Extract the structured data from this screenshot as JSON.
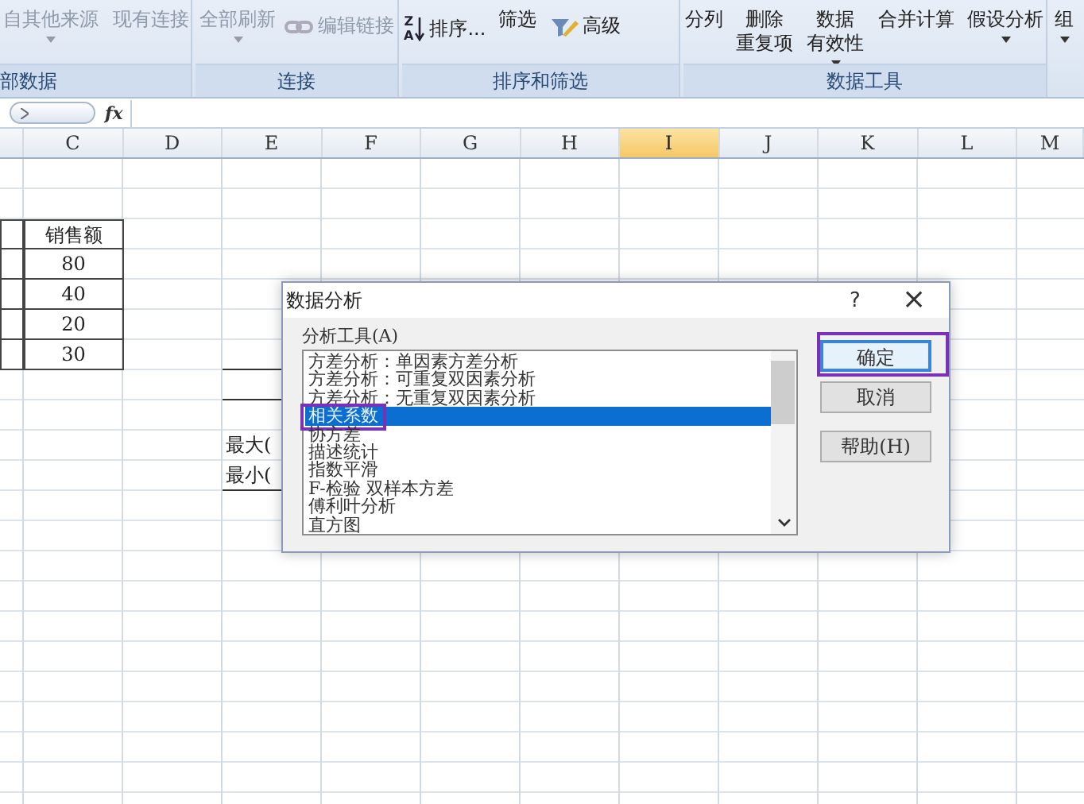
{
  "ribbon": {
    "groups": [
      {
        "label": "部数据",
        "items": [
          {
            "kind": "text",
            "lines": [
              "自其他来源"
            ],
            "caret": true,
            "disabled": true
          },
          {
            "kind": "text",
            "lines": [
              "现有连接"
            ],
            "caret": false,
            "disabled": true
          }
        ]
      },
      {
        "label": "连接",
        "items": [
          {
            "kind": "text",
            "lines": [
              "全部刷新"
            ],
            "caret": true,
            "disabled": true
          },
          {
            "kind": "link",
            "lines": [
              "编辑链接"
            ],
            "caret": false,
            "disabled": true
          }
        ]
      },
      {
        "label": "排序和筛选",
        "items": [
          {
            "kind": "sort",
            "icon_text": [
              "Z",
              "A"
            ],
            "lines": [
              "排序..."
            ],
            "caret": false,
            "disabled": false
          },
          {
            "kind": "text",
            "lines": [
              "筛选"
            ],
            "caret": false,
            "disabled": false
          },
          {
            "kind": "advanced",
            "lines": [
              "高级"
            ],
            "caret": false,
            "disabled": false
          }
        ]
      },
      {
        "label": "数据工具",
        "items": [
          {
            "kind": "text",
            "lines": [
              "分列"
            ],
            "caret": false,
            "disabled": false
          },
          {
            "kind": "text",
            "lines": [
              "删除",
              "重复项"
            ],
            "caret": false,
            "disabled": false
          },
          {
            "kind": "text",
            "lines": [
              "数据",
              "有效性"
            ],
            "caret": true,
            "disabled": false
          },
          {
            "kind": "text",
            "lines": [
              "合并计算"
            ],
            "caret": false,
            "disabled": false
          },
          {
            "kind": "text",
            "lines": [
              "假设分析"
            ],
            "caret": true,
            "disabled": false
          }
        ]
      },
      {
        "items": [
          {
            "kind": "text",
            "lines": [
              "组"
            ],
            "caret": true,
            "disabled": false
          }
        ]
      }
    ]
  },
  "formula_bar": {
    "fx": "fx"
  },
  "sheet": {
    "columns": [
      {
        "selected": false
      },
      {
        "label": "C",
        "selected": false
      },
      {
        "label": "D",
        "selected": false
      },
      {
        "label": "E",
        "selected": false
      },
      {
        "label": "F",
        "selected": false
      },
      {
        "label": "G",
        "selected": false
      },
      {
        "label": "H",
        "selected": false
      },
      {
        "label": "I",
        "selected": true
      },
      {
        "label": "J",
        "selected": false
      },
      {
        "label": "K",
        "selected": false
      },
      {
        "label": "L",
        "selected": false
      },
      {
        "label": "M",
        "selected": false
      }
    ],
    "table": {
      "header": "销售额",
      "values": [
        "80",
        "40",
        "20",
        "30"
      ]
    },
    "labels": [
      "最大(",
      "最小("
    ]
  },
  "dialog": {
    "title": "数据分析",
    "help": "?",
    "close": "×",
    "list_label": "分析工具(A)",
    "items": [
      {
        "text": "方差分析：单因素方差分析",
        "selected": false,
        "highlight": false
      },
      {
        "text": "方差分析：可重复双因素分析",
        "selected": false,
        "highlight": false
      },
      {
        "text": "方差分析：无重复双因素分析",
        "selected": false,
        "highlight": false
      },
      {
        "text": "相关系数",
        "selected": true,
        "highlight": true
      },
      {
        "text": "协方差",
        "selected": false,
        "highlight": false
      },
      {
        "text": "描述统计",
        "selected": false,
        "highlight": false
      },
      {
        "text": "指数平滑",
        "selected": false,
        "highlight": false
      },
      {
        "text": "F-检验 双样本方差",
        "selected": false,
        "highlight": false
      },
      {
        "text": "傅利叶分析",
        "selected": false,
        "highlight": false
      },
      {
        "text": "直方图",
        "selected": false,
        "highlight": false
      }
    ],
    "buttons": [
      {
        "text": "确定",
        "default": true,
        "highlight": true
      },
      {
        "text": "取消",
        "default": false,
        "highlight": false
      },
      {
        "text": "帮助(H)",
        "default": false,
        "highlight": false
      }
    ]
  }
}
